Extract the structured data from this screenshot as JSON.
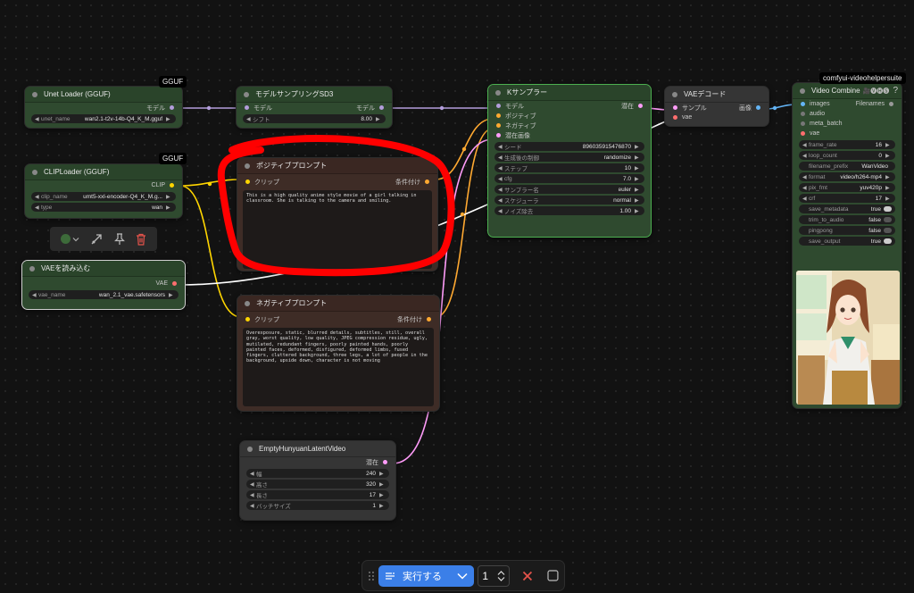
{
  "groups": {
    "gguf_1": "GGUF",
    "gguf_2": "GGUF",
    "vhs": "comfyui-videohelpersuite"
  },
  "unet_loader": {
    "title": "Unet Loader (GGUF)",
    "out_label": "モデル",
    "widget_label": "unet_name",
    "widget_value": "wan2.1-t2v-14b-Q4_K_M.gguf"
  },
  "model_sampling": {
    "title": "モデルサンプリングSD3",
    "in_label": "モデル",
    "out_label": "モデル",
    "widget_label": "シフト",
    "widget_value": "8.00"
  },
  "clip_loader": {
    "title": "CLIPLoader (GGUF)",
    "out_label": "CLIP",
    "widgets": [
      {
        "label": "clip_name",
        "value": "umt5-xxl-encoder-Q4_K_M.g..."
      },
      {
        "label": "type",
        "value": "wan"
      }
    ]
  },
  "vae_loader": {
    "title": "VAEを読み込む",
    "out_label": "VAE",
    "widget_label": "vae_name",
    "widget_value": "wan_2.1_vae.safetensors"
  },
  "positive_prompt": {
    "title": "ポジティブプロンプト",
    "in_label": "クリップ",
    "out_label": "条件付け",
    "text": "This is a high quality anime style movie of a girl talking in classroom. She is talking to the camera and smiling."
  },
  "negative_prompt": {
    "title": "ネガティブプロンプト",
    "in_label": "クリップ",
    "out_label": "条件付け",
    "text": "Overexposure, static, blurred details, subtitles, still, overall gray, worst quality, low quality, JPEG compression residue, ugly, mutilated, redundant fingers, poorly painted hands, poorly painted faces, deformed, disfigured, deformed limbs, fused fingers, cluttered background, three legs, a lot of people in the background, upside down, character is not moving"
  },
  "ksampler": {
    "title": "Kサンプラー",
    "out_label": "潜在",
    "inputs": [
      "モデル",
      "ポジティブ",
      "ネガティブ",
      "潜在画像"
    ],
    "widgets": [
      {
        "label": "シード",
        "value": "896035915476870"
      },
      {
        "label": "生成後の制御",
        "value": "randomize"
      },
      {
        "label": "ステップ",
        "value": "10"
      },
      {
        "label": "cfg",
        "value": "7.0"
      },
      {
        "label": "サンプラー名",
        "value": "euler"
      },
      {
        "label": "スケジューラ",
        "value": "normal"
      },
      {
        "label": "ノイズ除去",
        "value": "1.00"
      }
    ]
  },
  "vae_decode": {
    "title": "VAEデコード",
    "inputs": [
      "サンプル",
      "vae"
    ],
    "out_label": "画像"
  },
  "empty_latent": {
    "title": "EmptyHunyuanLatentVideo",
    "out_label": "潜在",
    "widgets": [
      {
        "label": "幅",
        "value": "240"
      },
      {
        "label": "高さ",
        "value": "320"
      },
      {
        "label": "長さ",
        "value": "17"
      },
      {
        "label": "バッチサイズ",
        "value": "1"
      }
    ]
  },
  "video_combine": {
    "title": "Video Combine",
    "title_icons": "🎥🅥🅗🅢",
    "help": "?",
    "inputs": [
      "images",
      "audio",
      "meta_batch",
      "vae"
    ],
    "out_label": "Filenames",
    "widgets": [
      {
        "label": "frame_rate",
        "value": "16",
        "kind": "num"
      },
      {
        "label": "loop_count",
        "value": "0",
        "kind": "num"
      },
      {
        "label": "filename_prefix",
        "value": "WanVideo",
        "kind": "text"
      },
      {
        "label": "format",
        "value": "video/h264-mp4",
        "kind": "num"
      },
      {
        "label": "pix_fmt",
        "value": "yuv420p",
        "kind": "num"
      },
      {
        "label": "crf",
        "value": "17",
        "kind": "num"
      },
      {
        "label": "save_metadata",
        "value": "true",
        "kind": "toggle"
      },
      {
        "label": "trim_to_audio",
        "value": "false",
        "kind": "toggle"
      },
      {
        "label": "pingpong",
        "value": "false",
        "kind": "toggle"
      },
      {
        "label": "save_output",
        "value": "true",
        "kind": "toggle"
      }
    ]
  },
  "bottom_bar": {
    "run_label": "実行する",
    "batch_count": "1"
  },
  "colors": {
    "model": "#b39ddb",
    "clip": "#ffd500",
    "vae": "#ff6e6e",
    "conditioning": "#ffa931",
    "latent": "#ff9cf9",
    "image": "#64b5f6",
    "annotation": "#ff0000",
    "accent": "#3b7fe8"
  },
  "icons": [
    "color-dot-icon",
    "chevron-down-icon",
    "bypass-icon",
    "pin-icon",
    "trash-icon",
    "grip-icon",
    "queue-icon",
    "close-icon",
    "checkbox-icon"
  ]
}
